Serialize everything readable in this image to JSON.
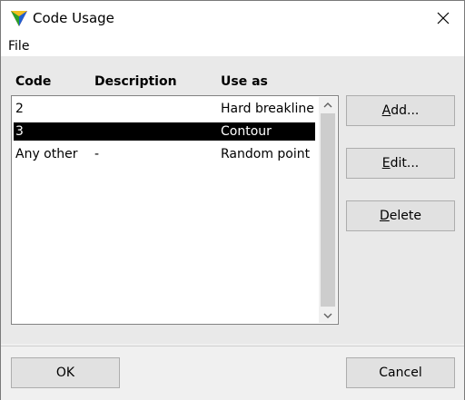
{
  "window": {
    "title": "Code Usage"
  },
  "menu": {
    "file": "File"
  },
  "table": {
    "headers": [
      "Code",
      "Description",
      "Use as"
    ],
    "rows": [
      {
        "code": "2",
        "description": "",
        "use_as": "Hard breakline",
        "selected": false
      },
      {
        "code": "3",
        "description": "",
        "use_as": "Contour",
        "selected": true
      },
      {
        "code": "Any other",
        "description": "-",
        "use_as": "Random point",
        "selected": false
      }
    ]
  },
  "buttons": {
    "add_mn": "A",
    "add_rest": "dd...",
    "edit_mn": "E",
    "edit_rest": "dit...",
    "delete_mn": "D",
    "delete_rest": "elete",
    "ok": "OK",
    "cancel": "Cancel"
  },
  "colors": {
    "selection": "#000000",
    "panel": "#e9e9e9",
    "button": "#e1e1e1"
  },
  "icons": [
    "app-icon",
    "close-icon",
    "chevron-up-icon",
    "chevron-down-icon"
  ]
}
